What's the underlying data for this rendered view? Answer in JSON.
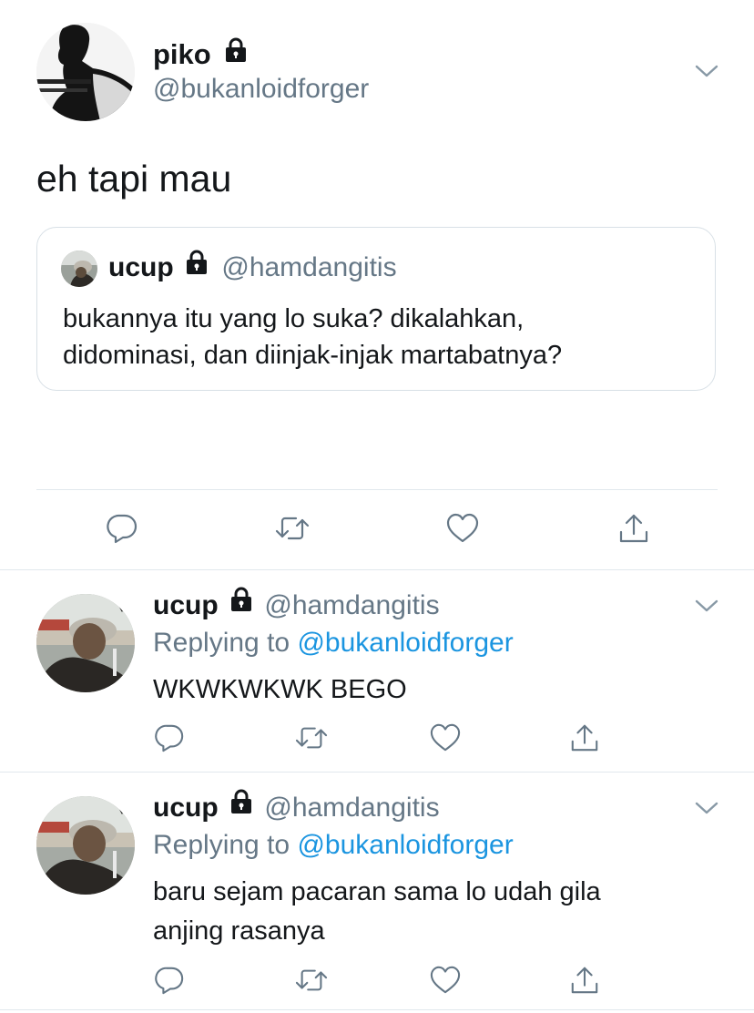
{
  "main_tweet": {
    "name": "piko",
    "handle": "@bukanloidforger",
    "text": "eh tapi mau",
    "quote": {
      "name": "ucup",
      "handle": "@hamdangitis",
      "text_line1": "bukannya itu yang lo suka? dikalahkan,",
      "text_line2": "didominasi, dan diinjak-injak martabatnya?"
    }
  },
  "replies": [
    {
      "name": "ucup",
      "handle": "@hamdangitis",
      "replying_prefix": "Replying to",
      "replying_to": "@bukanloidforger",
      "text_line1": "WKWKWKWK BEGO",
      "text_line2": ""
    },
    {
      "name": "ucup",
      "handle": "@hamdangitis",
      "replying_prefix": "Replying to",
      "replying_to": "@bukanloidforger",
      "text_line1": "baru sejam pacaran sama lo udah gila",
      "text_line2": "anjing rasanya"
    }
  ],
  "icons": [
    "lock-icon",
    "chevron-down-icon",
    "reply-icon",
    "retweet-icon",
    "like-icon",
    "share-icon"
  ],
  "colors": {
    "text": "#14171a",
    "secondary": "#657786",
    "link": "#1b95e0",
    "border": "#e1e8ed"
  }
}
